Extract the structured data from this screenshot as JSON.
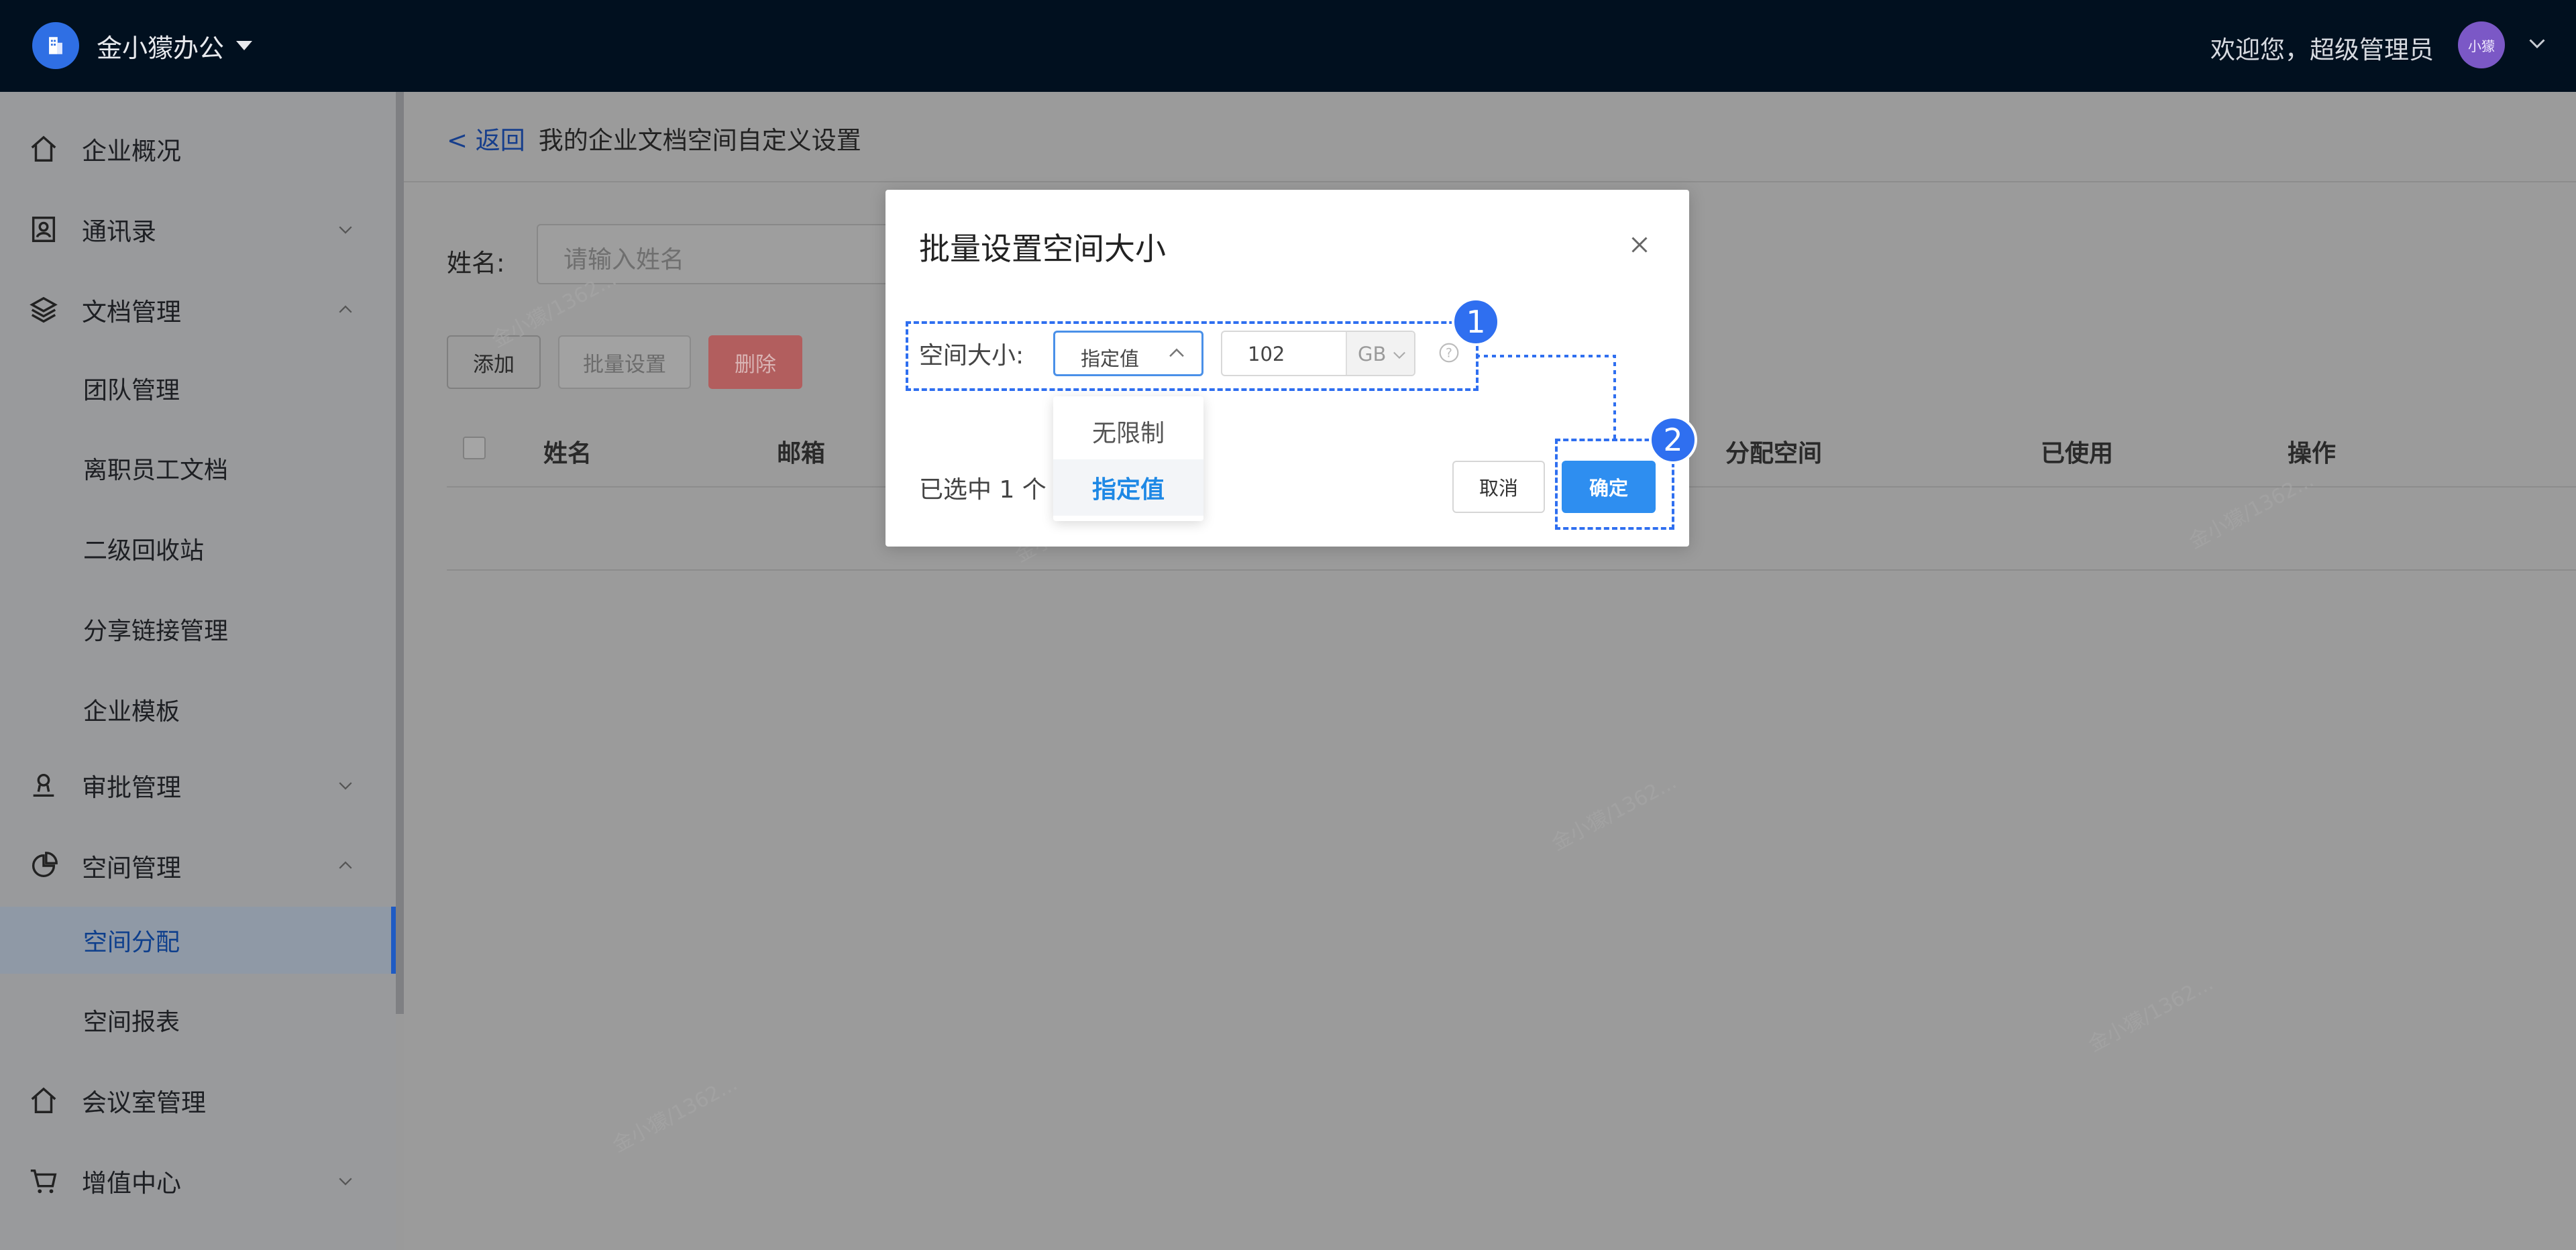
{
  "header": {
    "brand_name": "金小獴办公",
    "welcome": "欢迎您，超级管理员",
    "avatar_text": "小獴"
  },
  "sidebar": {
    "items": [
      {
        "label": "企业概况",
        "icon": "home-icon"
      },
      {
        "label": "通讯录",
        "icon": "contact-card-icon",
        "chevron": "down"
      },
      {
        "label": "文档管理",
        "icon": "layers-icon",
        "chevron": "up"
      },
      {
        "label": "团队管理"
      },
      {
        "label": "离职员工文档"
      },
      {
        "label": "二级回收站"
      },
      {
        "label": "分享链接管理"
      },
      {
        "label": "企业模板"
      },
      {
        "label": "审批管理",
        "icon": "user-icon",
        "chevron": "down"
      },
      {
        "label": "空间管理",
        "icon": "pie-chart-icon",
        "chevron": "up"
      },
      {
        "label": "空间分配",
        "active": true
      },
      {
        "label": "空间报表"
      },
      {
        "label": "会议室管理",
        "icon": "home-icon"
      },
      {
        "label": "增值中心",
        "icon": "cart-icon",
        "chevron": "down"
      }
    ]
  },
  "page": {
    "back": "< 返回",
    "title": "我的企业文档空间自定义设置",
    "name_label": "姓名:",
    "name_placeholder": "请输入姓名",
    "buttons": {
      "add": "添加",
      "batch": "批量设置",
      "delete": "删除"
    },
    "columns": [
      "姓名",
      "邮箱",
      "分配空间",
      "已使用",
      "操作"
    ],
    "watermark": "金小獴/1362..."
  },
  "dialog": {
    "title": "批量设置空间大小",
    "field_label": "空间大小:",
    "select_value": "指定值",
    "size_value": "102",
    "unit": "GB",
    "options": [
      "无限制",
      "指定值"
    ],
    "selected_count": "已选中 1 个",
    "cancel": "取消",
    "confirm": "确定"
  },
  "annotations": {
    "badge1": "1",
    "badge2": "2",
    "color": "#2f6ff0"
  }
}
